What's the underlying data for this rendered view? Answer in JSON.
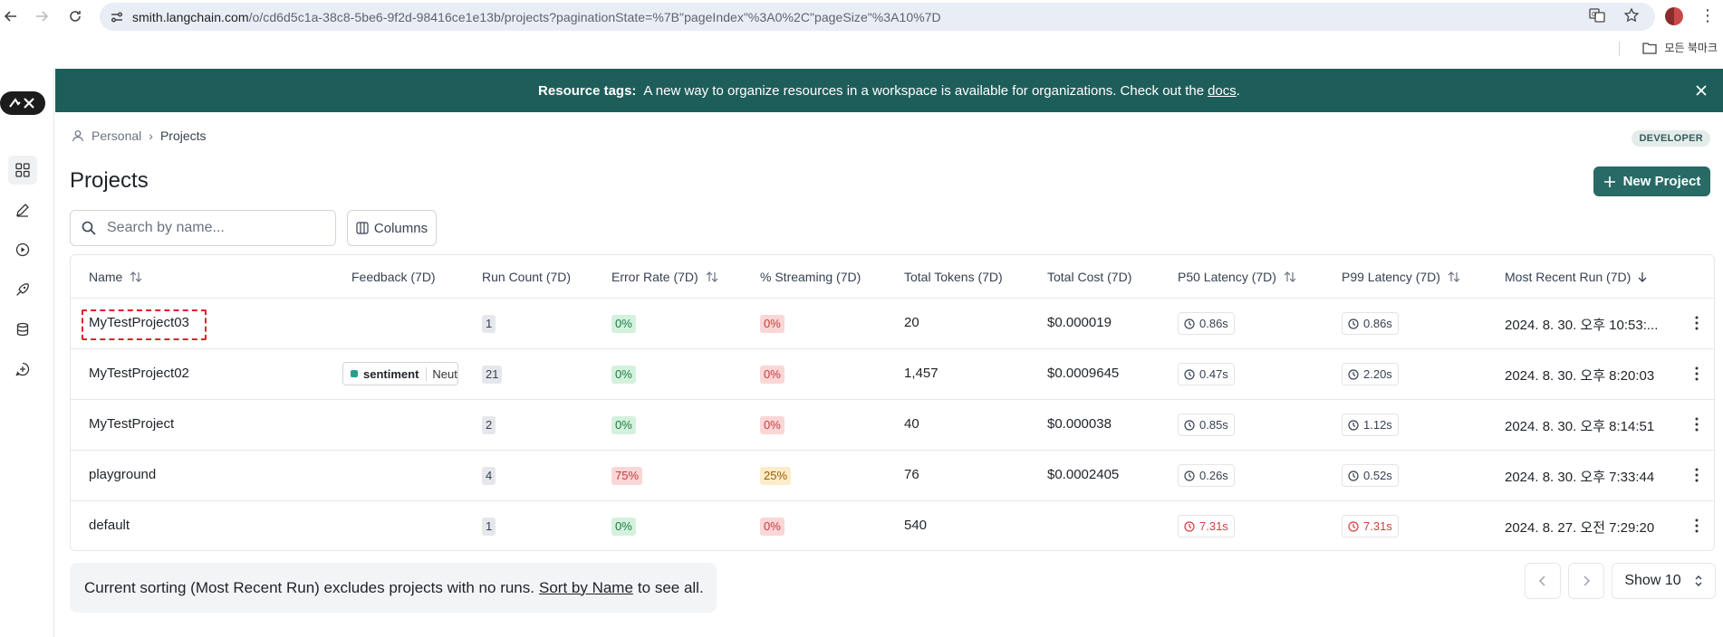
{
  "browser": {
    "url_main": "smith.langchain.com",
    "url_rest": "/o/cd6d5c1a-38c8-5be6-9f2d-98416ce1e13b/projects?paginationState=%7B\"pageIndex\"%3A0%2C\"pageSize\"%3A10%7D",
    "bookmarks_label": "모든 북마크"
  },
  "banner": {
    "label": "Resource tags:",
    "text": "A new way to organize resources in a workspace is available for organizations. Check out the",
    "link": "docs",
    "tail": "."
  },
  "breadcrumb": {
    "root": "Personal",
    "current": "Projects"
  },
  "badge": "DEVELOPER",
  "page_title": "Projects",
  "new_project_label": "New Project",
  "search": {
    "placeholder": "Search by name..."
  },
  "columns_label": "Columns",
  "table": {
    "headers": {
      "name": "Name",
      "feedback": "Feedback (7D)",
      "run_count": "Run Count (7D)",
      "error_rate": "Error Rate (7D)",
      "streaming": "% Streaming (7D)",
      "tokens": "Total Tokens (7D)",
      "cost": "Total Cost (7D)",
      "p50": "P50 Latency (7D)",
      "p99": "P99 Latency (7D)",
      "recent": "Most Recent Run (7D)"
    },
    "rows": [
      {
        "name": "MyTestProject03",
        "feedback_key": "",
        "feedback_val": "",
        "runs": "1",
        "error": "0%",
        "stream": "0%",
        "tokens": "20",
        "cost": "$0.000019",
        "p50": "0.86s",
        "p99": "0.86s",
        "recent": "2024. 8. 30. 오후 10:53:..."
      },
      {
        "name": "MyTestProject02",
        "feedback_key": "sentiment",
        "feedback_val": "Neut",
        "runs": "21",
        "error": "0%",
        "stream": "0%",
        "tokens": "1,457",
        "cost": "$0.0009645",
        "p50": "0.47s",
        "p99": "2.20s",
        "recent": "2024. 8. 30. 오후 8:20:03"
      },
      {
        "name": "MyTestProject",
        "feedback_key": "",
        "feedback_val": "",
        "runs": "2",
        "error": "0%",
        "stream": "0%",
        "tokens": "40",
        "cost": "$0.000038",
        "p50": "0.85s",
        "p99": "1.12s",
        "recent": "2024. 8. 30. 오후 8:14:51"
      },
      {
        "name": "playground",
        "feedback_key": "",
        "feedback_val": "",
        "runs": "4",
        "error": "75%",
        "stream": "25%",
        "tokens": "76",
        "cost": "$0.0002405",
        "p50": "0.26s",
        "p99": "0.52s",
        "recent": "2024. 8. 30. 오후 7:33:44"
      },
      {
        "name": "default",
        "feedback_key": "",
        "feedback_val": "",
        "runs": "1",
        "error": "0%",
        "stream": "0%",
        "tokens": "540",
        "cost": "",
        "p50": "7.31s",
        "p99": "7.31s",
        "recent": "2024. 8. 27. 오전 7:29:20"
      }
    ]
  },
  "notice": {
    "before": "Current sorting (Most Recent Run) excludes projects with no runs.",
    "link": "Sort by Name",
    "after": "to see all."
  },
  "pagination": {
    "show_label": "Show 10"
  },
  "colors": {
    "banner": "#1e5e5a",
    "primary_button": "#276a66",
    "highlight": "#e0202a"
  }
}
